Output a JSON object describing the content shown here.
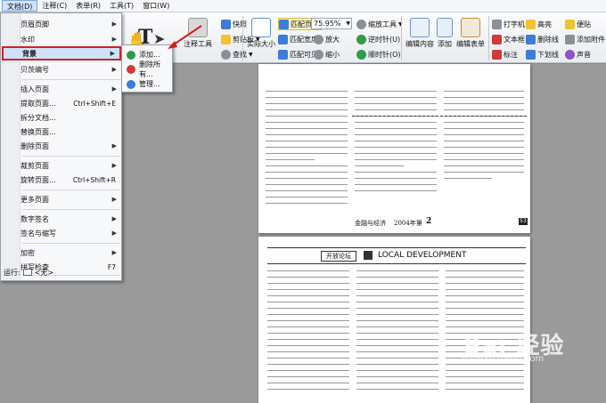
{
  "menubar": {
    "items": [
      "文档(D)",
      "注释(C)",
      "表单(R)",
      "工具(T)",
      "窗口(W)"
    ]
  },
  "toolbar": {
    "quick_pdf": "快照",
    "clipboard": "剪贴板",
    "find": "查找",
    "actual_size": "实际大小",
    "fit_page": "匹配页面",
    "fit_width": "匹配宽度",
    "fit_visible": "匹配可见",
    "zoom_value": "75.95%",
    "zoom_in": "放大",
    "zoom_out": "缩小",
    "zoom_tool": "缩放工具",
    "rotate_ccw": "逆时针(U)",
    "rotate_cw": "顺时针(O)",
    "edit_content": "编辑内容",
    "add": "添加",
    "edit_form": "编辑表单",
    "typewriter": "打字机",
    "textbox": "文本框",
    "callout": "标注",
    "highlight": "高亮",
    "strikeout": "删除线",
    "underline": "下划线",
    "note": "便贴",
    "attach": "添加附件",
    "sound": "声音",
    "annot_tool": "注释工具"
  },
  "doc_menu": {
    "items": [
      {
        "label": "页眉页脚",
        "shortcut": "",
        "sub": true
      },
      {
        "label": "水印",
        "shortcut": "",
        "sub": true
      },
      {
        "label": "背景",
        "shortcut": "",
        "sub": true
      },
      {
        "label": "贝茨编号",
        "shortcut": "",
        "sub": true
      },
      {
        "label": "插入页面",
        "shortcut": "",
        "sub": true
      },
      {
        "label": "提取页面...",
        "shortcut": "Ctrl+Shift+E",
        "sub": false
      },
      {
        "label": "拆分文档...",
        "shortcut": "",
        "sub": false
      },
      {
        "label": "替换页面...",
        "shortcut": "",
        "sub": false
      },
      {
        "label": "删除页面",
        "shortcut": "",
        "sub": true
      },
      {
        "label": "裁剪页面",
        "shortcut": "",
        "sub": true
      },
      {
        "label": "旋转页面...",
        "shortcut": "Ctrl+Shift+R",
        "sub": false
      },
      {
        "label": "更多页面",
        "shortcut": "",
        "sub": true
      },
      {
        "label": "数字签名",
        "shortcut": "",
        "sub": true
      },
      {
        "label": "签名与缩写",
        "shortcut": "",
        "sub": true
      },
      {
        "label": "加密",
        "shortcut": "",
        "sub": true
      },
      {
        "label": "拼写检查",
        "shortcut": "F7",
        "sub": false
      }
    ],
    "run_label": "运行:",
    "run_value": "<无>"
  },
  "background_submenu": {
    "items": [
      "添加...",
      "删除所有...",
      "管理..."
    ]
  },
  "document": {
    "page1_footer_title": "金融与经济",
    "page1_footer_issue": "2004年第",
    "page1_footer_num": "2",
    "page1_pgno": "53",
    "page2_header_left": "开放论坛",
    "page2_header_right": "LOCAL DEVELOPMENT"
  },
  "watermark": {
    "main": "Bai 经验",
    "sub": "jingyan.baidu.com"
  },
  "colors": {
    "menu_highlight_border": "#d42020",
    "menu_highlight_fill": "#cfe2fb",
    "accent_blue": "#3b7dd8"
  }
}
